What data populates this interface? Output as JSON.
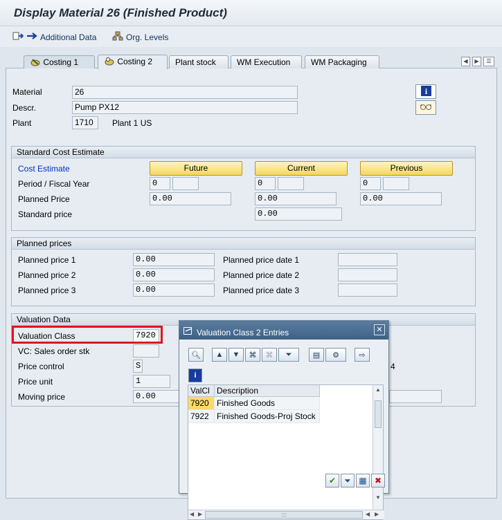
{
  "window": {
    "title": "Display Material 26 (Finished Product)"
  },
  "appbar": {
    "additional_data": "Additional Data",
    "org_levels": "Org. Levels"
  },
  "tabs": [
    "Costing 1",
    "Costing 2",
    "Plant stock",
    "WM Execution",
    "WM Packaging"
  ],
  "header": {
    "material_label": "Material",
    "material_value": "26",
    "descr_label": "Descr.",
    "descr_value": "Pump PX12",
    "plant_label": "Plant",
    "plant_value": "1710",
    "plant_text": "Plant 1 US"
  },
  "std_cost": {
    "title": "Standard Cost Estimate",
    "cost_estimate_label": "Cost Estimate",
    "future_label": "Future",
    "current_label": "Current",
    "previous_label": "Previous",
    "period_label": "Period / Fiscal Year",
    "future_period": "0",
    "current_period": "0",
    "previous_period": "0",
    "planned_price_label": "Planned Price",
    "future_planned": "0.00",
    "current_planned": "0.00",
    "previous_planned": "0.00",
    "standard_price_label": "Standard price",
    "current_standard": "0.00"
  },
  "planned_prices": {
    "title": "Planned prices",
    "rows": [
      {
        "label": "Planned price 1",
        "value": "0.00",
        "date_label": "Planned price date 1"
      },
      {
        "label": "Planned price 2",
        "value": "0.00",
        "date_label": "Planned price date 2"
      },
      {
        "label": "Planned price 3",
        "value": "0.00",
        "date_label": "Planned price date 3"
      }
    ]
  },
  "valuation": {
    "title": "Valuation Data",
    "class_label": "Valuation Class",
    "class_value": "7920",
    "vc_label": "VC: Sales order stk",
    "price_control_label": "Price control",
    "price_control_value": "S",
    "price_unit_label": "Price unit",
    "price_unit_value": "1",
    "moving_price_label": "Moving price",
    "moving_price_value": "0.00",
    "partial_digit": "4"
  },
  "popup": {
    "title": "Valuation Class 2 Entries",
    "col_valcl": "ValCl",
    "col_desc": "Description",
    "rows": [
      {
        "valcl": "7920",
        "desc": "Finished Goods"
      },
      {
        "valcl": "7922",
        "desc": "Finished Goods-Proj Stock"
      }
    ],
    "scroll_grip": ":::"
  }
}
